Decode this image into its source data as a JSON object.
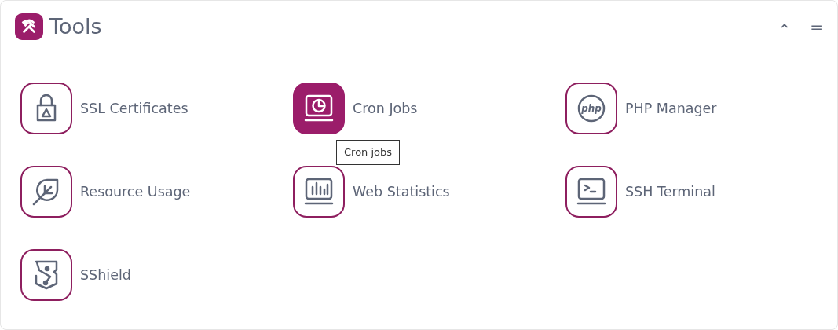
{
  "panel": {
    "title": "Tools",
    "collapse_icon": "⌃",
    "menu_icon": "="
  },
  "tools": [
    {
      "label": "SSL Certificates",
      "hovered": false
    },
    {
      "label": "Cron Jobs",
      "hovered": true,
      "tooltip": "Cron jobs"
    },
    {
      "label": "PHP Manager",
      "icon_text": "php",
      "hovered": false
    },
    {
      "label": "Resource Usage",
      "hovered": false
    },
    {
      "label": "Web Statistics",
      "hovered": false
    },
    {
      "label": "SSH Terminal",
      "hovered": false
    },
    {
      "label": "SShield",
      "hovered": false
    }
  ]
}
